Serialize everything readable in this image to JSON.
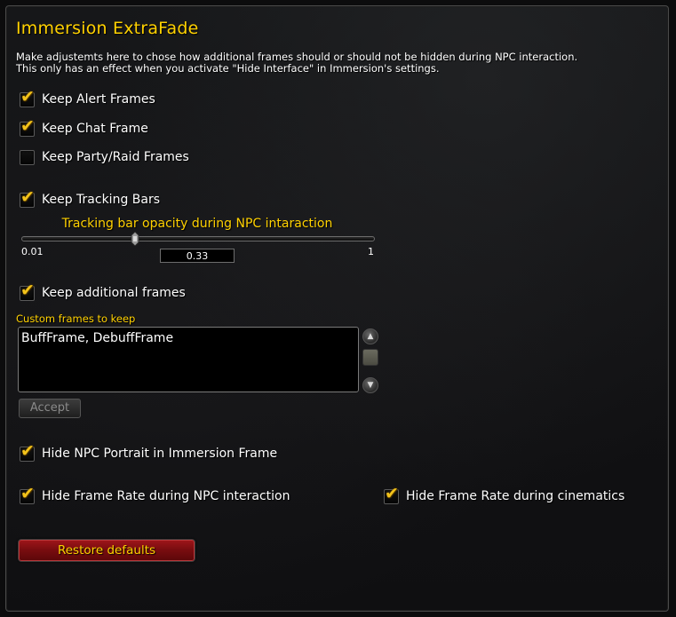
{
  "title": "Immersion ExtraFade",
  "description": "Make adjustemts here to chose how additional frames should or should not be hidden during NPC interaction.\nThis only has an effect when you activate \"Hide Interface\" in Immersion's settings.",
  "options": {
    "keep_alert_frames": {
      "label": "Keep Alert Frames",
      "checked": true
    },
    "keep_chat_frame": {
      "label": "Keep Chat Frame",
      "checked": true
    },
    "keep_party_raid_frames": {
      "label": "Keep Party/Raid Frames",
      "checked": false
    },
    "keep_tracking_bars": {
      "label": "Keep Tracking Bars",
      "checked": true
    },
    "keep_additional_frames": {
      "label": "Keep additional frames",
      "checked": true
    },
    "hide_npc_portrait": {
      "label": "Hide NPC Portrait in Immersion Frame",
      "checked": true
    },
    "hide_frame_rate_npc": {
      "label": "Hide Frame Rate during NPC interaction",
      "checked": true
    },
    "hide_frame_rate_cinematics": {
      "label": "Hide Frame Rate during cinematics",
      "checked": true
    }
  },
  "slider": {
    "label": "Tracking bar opacity during NPC intaraction",
    "min_label": "0.01",
    "max_label": "1",
    "min": 0.01,
    "max": 1,
    "value": 0.33,
    "value_text": "0.33"
  },
  "custom_frames": {
    "label": "Custom frames to keep",
    "value": "BuffFrame, DebuffFrame",
    "accept_label": "Accept"
  },
  "restore_label": "Restore defaults",
  "colors": {
    "title_gold": "#ffd100",
    "check_gold": "#f2c21a",
    "restore_red": "#8a0f12"
  },
  "icons": {
    "check": "✔",
    "scroll_up": "▲",
    "scroll_down": "▼"
  }
}
